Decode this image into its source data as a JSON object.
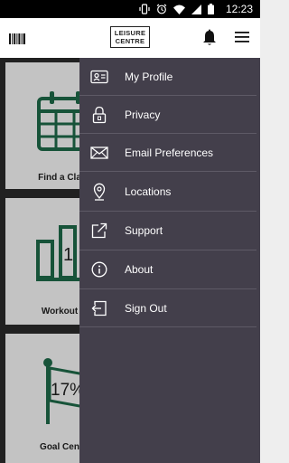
{
  "status_bar": {
    "time": "12:23"
  },
  "header": {
    "logo_line1": "LEISURE",
    "logo_line2": "CENTRE"
  },
  "tiles": [
    {
      "label": "Find a Cla"
    },
    {
      "label": "Workout",
      "number": "1"
    },
    {
      "label": "Goal Cen",
      "percent": "17%"
    }
  ],
  "drawer": {
    "items": [
      {
        "label": "My Profile",
        "icon": "id-card-icon"
      },
      {
        "label": "Privacy",
        "icon": "lock-icon"
      },
      {
        "label": "Email Preferences",
        "icon": "envelope-icon"
      },
      {
        "label": "Locations",
        "icon": "location-pin-icon"
      },
      {
        "label": "Support",
        "icon": "external-link-icon"
      },
      {
        "label": "About",
        "icon": "info-icon"
      },
      {
        "label": "Sign Out",
        "icon": "sign-out-icon"
      }
    ]
  },
  "colors": {
    "drawer_bg": "#433f4b",
    "accent_green": "#1e6b4a"
  }
}
